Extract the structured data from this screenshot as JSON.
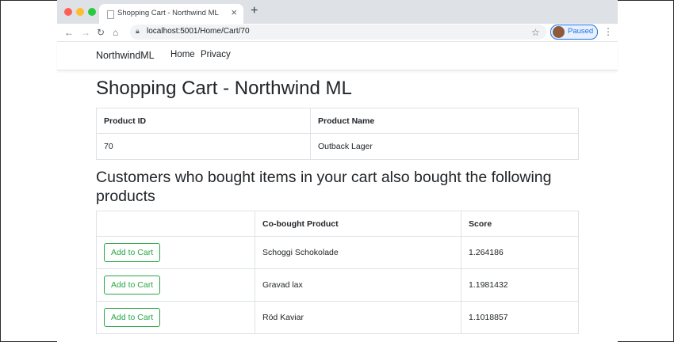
{
  "browser": {
    "tab_title": "Shopping Cart - Northwind ML",
    "tab_close": "×",
    "new_tab": "+",
    "url": "localhost:5001/Home/Cart/70",
    "profile_status": "Paused",
    "icons": [
      "back-icon",
      "forward-icon",
      "reload-icon",
      "home-icon",
      "lock-icon",
      "star-icon",
      "menu-icon"
    ]
  },
  "navbar": {
    "brand": "NorthwindML",
    "links": [
      "Home",
      "Privacy"
    ]
  },
  "page": {
    "title": "Shopping Cart - Northwind ML",
    "cart_table": {
      "headers": [
        "Product ID",
        "Product Name"
      ],
      "rows": [
        [
          "70",
          "Outback Lager"
        ]
      ]
    },
    "recommend_title": "Customers who bought items in your cart also bought the following products",
    "recommend_table": {
      "headers": [
        "",
        "Co-bought Product",
        "Score"
      ],
      "button_label": "Add to Cart",
      "rows": [
        {
          "product": "Schoggi Schokolade",
          "score": "1.264186"
        },
        {
          "product": "Gravad lax",
          "score": "1.1981432"
        },
        {
          "product": "Röd Kaviar",
          "score": "1.1018857"
        }
      ]
    }
  },
  "colors": {
    "button_green": "#28a745",
    "tabstrip": "#dee1e6",
    "profile_blue": "#1a73e8"
  }
}
